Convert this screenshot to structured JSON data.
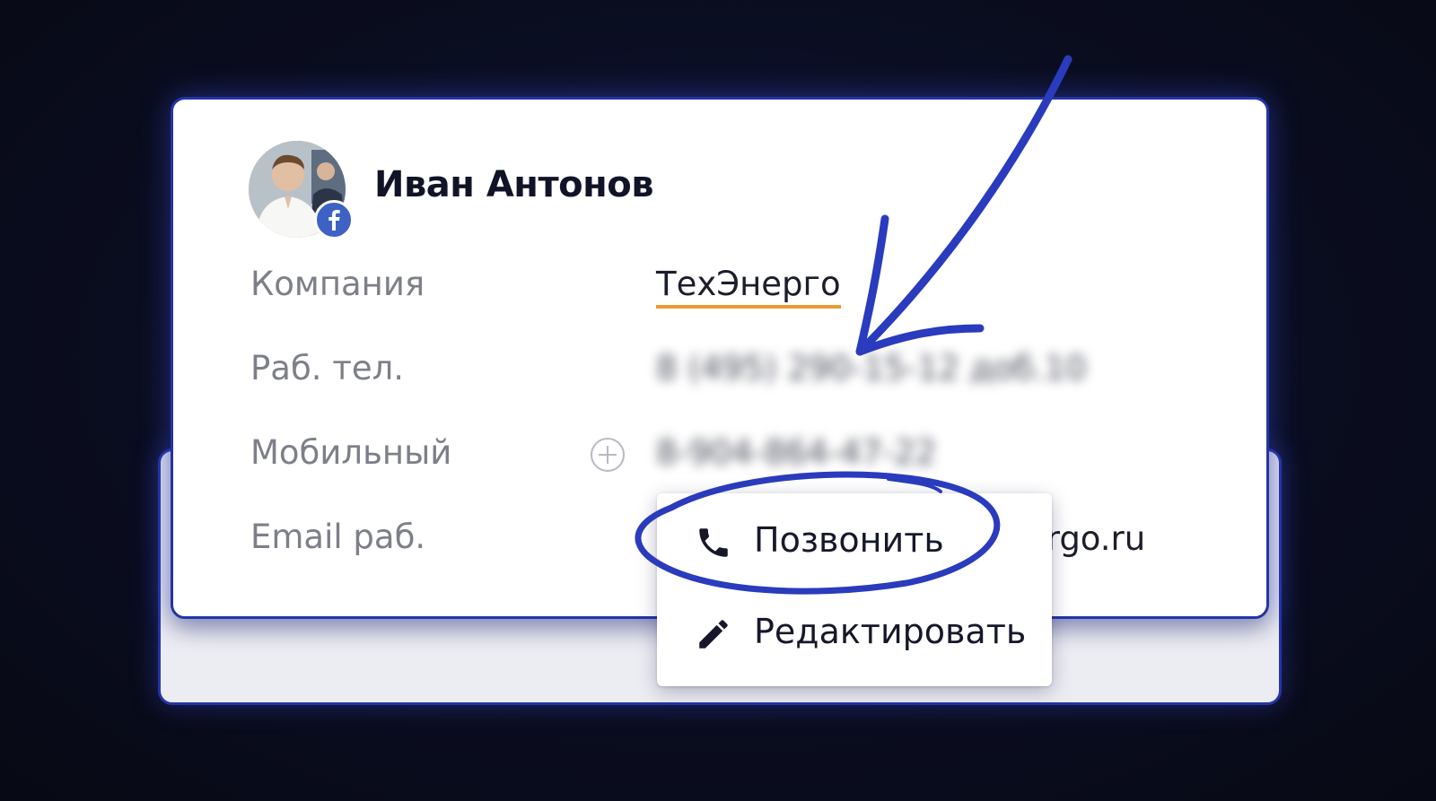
{
  "contact": {
    "name": "Иван Антонов",
    "avatar_badge_icon": "facebook-icon"
  },
  "fields": {
    "company": {
      "label": "Компания",
      "value": "ТехЭнерго"
    },
    "work_phone": {
      "label": "Раб. тел.",
      "value": "8 (495) 290-15-12 доб.10"
    },
    "mobile": {
      "label": "Мобильный",
      "value": "8-904-864-47-22",
      "add_icon": "plus-circle-icon"
    },
    "work_email": {
      "label": "Email раб.",
      "value_visible": "ergo.ru"
    }
  },
  "context_menu": {
    "items": [
      {
        "label": "Позвонить",
        "icon": "phone-icon"
      },
      {
        "label": "Редактировать",
        "icon": "pencil-icon"
      }
    ]
  },
  "colors": {
    "accent_blue": "#2434a8",
    "company_underline": "#ea9a34",
    "facebook": "#3d62c4",
    "background": "#0a0d1f"
  }
}
